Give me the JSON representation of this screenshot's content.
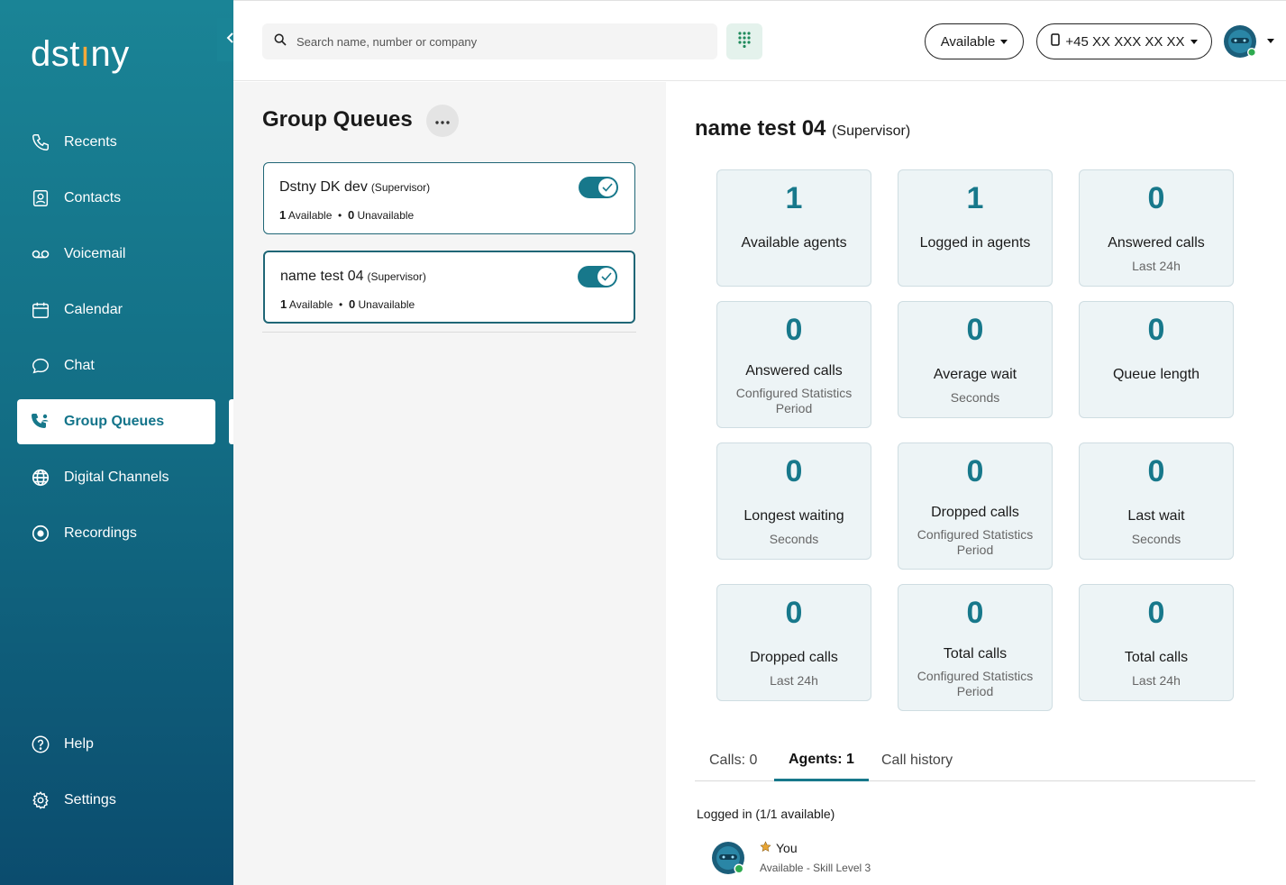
{
  "brand": {
    "logo_pre": "dst",
    "logo_dot": "ı",
    "logo_post": "ny",
    "accent": "#17788b",
    "sidebar_top": "#1a8496",
    "sidebar_bottom": "#0b4c6e",
    "logo_dot_color": "#f4a93b"
  },
  "sidebar": {
    "collapse_icon": "chevron-left-icon",
    "items": [
      {
        "label": "Recents",
        "icon": "phone-icon"
      },
      {
        "label": "Contacts",
        "icon": "contact-card-icon"
      },
      {
        "label": "Voicemail",
        "icon": "voicemail-icon"
      },
      {
        "label": "Calendar",
        "icon": "calendar-icon"
      },
      {
        "label": "Chat",
        "icon": "chat-bubble-icon"
      },
      {
        "label": "Group Queues",
        "icon": "group-phone-icon",
        "active": true
      },
      {
        "label": "Digital Channels",
        "icon": "globe-icon"
      },
      {
        "label": "Recordings",
        "icon": "record-icon"
      }
    ],
    "bottom_items": [
      {
        "label": "Help",
        "icon": "help-icon"
      },
      {
        "label": "Settings",
        "icon": "gear-icon"
      }
    ]
  },
  "topbar": {
    "search_placeholder": "Search name, number or company",
    "status_label": "Available",
    "phone_label": "+45 XX XXX XX XX",
    "presence_color": "#2eaa4f"
  },
  "middle": {
    "title": "Group Queues",
    "queues": [
      {
        "name": "Dstny DK dev",
        "role": "(Supervisor)",
        "available_count": "1",
        "available_label": "Available",
        "unavailable_count": "0",
        "unavailable_label": "Unavailable",
        "enabled": true
      },
      {
        "name": "name test 04",
        "role": "(Supervisor)",
        "available_count": "1",
        "available_label": "Available",
        "unavailable_count": "0",
        "unavailable_label": "Unavailable",
        "enabled": true,
        "selected": true
      }
    ]
  },
  "detail": {
    "title": "name test 04",
    "role": "(Supervisor)",
    "stats": [
      {
        "value": "1",
        "label": "Available agents",
        "sub": ""
      },
      {
        "value": "1",
        "label": "Logged in agents",
        "sub": ""
      },
      {
        "value": "0",
        "label": "Answered calls",
        "sub": "Last 24h"
      },
      {
        "value": "0",
        "label": "Answered calls",
        "sub": "Configured Statistics Period"
      },
      {
        "value": "0",
        "label": "Average wait",
        "sub": "Seconds"
      },
      {
        "value": "0",
        "label": "Queue length",
        "sub": ""
      },
      {
        "value": "0",
        "label": "Longest waiting",
        "sub": "Seconds"
      },
      {
        "value": "0",
        "label": "Dropped calls",
        "sub": "Configured Statistics Period"
      },
      {
        "value": "0",
        "label": "Last wait",
        "sub": "Seconds"
      },
      {
        "value": "0",
        "label": "Dropped calls",
        "sub": "Last 24h"
      },
      {
        "value": "0",
        "label": "Total calls",
        "sub": "Configured Statistics Period"
      },
      {
        "value": "0",
        "label": "Total calls",
        "sub": "Last 24h"
      }
    ],
    "tabs": [
      {
        "label": "Calls: 0"
      },
      {
        "label": "Agents: 1",
        "active": true
      },
      {
        "label": "Call history"
      }
    ],
    "logged_in_label": "Logged in (1/1 available)",
    "agent": {
      "name": "You",
      "status": "Available - Skill Level 3",
      "star_color": "#e7a534"
    }
  }
}
